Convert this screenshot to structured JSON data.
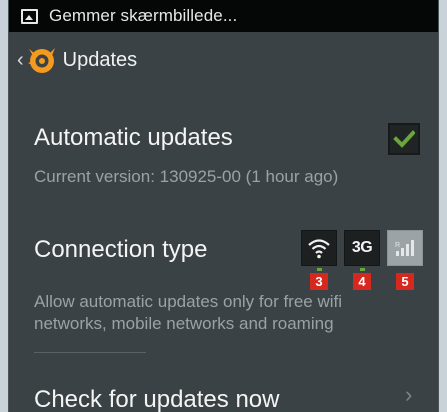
{
  "statusbar": {
    "notification_icon": "image-icon",
    "text": "Gemmer skærmbillede..."
  },
  "actionbar": {
    "back_icon": "chevron-left-icon",
    "back_glyph": "‹",
    "logo": "avast-logo",
    "title": "Updates"
  },
  "settings": {
    "automatic_updates": {
      "title": "Automatic updates",
      "summary": "Current version: 130925-00 (1 hour ago)",
      "checked": true
    },
    "connection_type": {
      "title": "Connection type",
      "summary_line1": "Allow automatic updates only for free wifi",
      "summary_line2": "networks, mobile networks and roaming",
      "options": [
        {
          "icon": "wifi-icon",
          "badge": "3",
          "enabled": true
        },
        {
          "icon": "3g-icon",
          "label": "3G",
          "badge": "4",
          "enabled": true
        },
        {
          "icon": "signal-roaming-icon",
          "badge": "5",
          "enabled": false
        }
      ]
    },
    "check_now": {
      "title": "Check for updates now",
      "chevron_glyph": "›"
    }
  },
  "colors": {
    "background": "#3b4245",
    "statusbar": "#050606",
    "accent_green": "#6aa63a",
    "badge_red": "#d6281f",
    "logo_orange": "#f39a1f"
  }
}
